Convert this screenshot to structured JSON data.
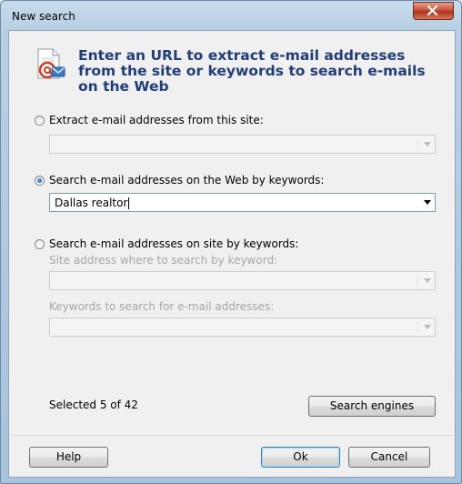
{
  "window": {
    "title": "New search"
  },
  "heading": "Enter an URL to extract e-mail addresses from the site or keywords to search e-mails on the Web",
  "options": {
    "site": {
      "label": "Extract e-mail addresses from this site:",
      "checked": false,
      "value": ""
    },
    "web": {
      "label": "Search e-mail addresses on the Web by keywords:",
      "checked": true,
      "value": "Dallas realtor"
    },
    "site_keywords": {
      "label": "Search e-mail addresses on site by keywords:",
      "checked": false,
      "site_label": "Site address where to search by keyword:",
      "keywords_label": "Keywords to search for e-mail addresses:"
    }
  },
  "status": {
    "selected": "Selected 5 of 42"
  },
  "buttons": {
    "search_engines": "Search engines",
    "help": "Help",
    "ok": "Ok",
    "cancel": "Cancel"
  },
  "icons": [
    "close-icon",
    "email-search-icon",
    "dropdown-arrow-icon"
  ],
  "colors": {
    "heading": "#1f3d7a",
    "close_button": "#c8523a",
    "disabled_text": "#a2a8ae"
  }
}
